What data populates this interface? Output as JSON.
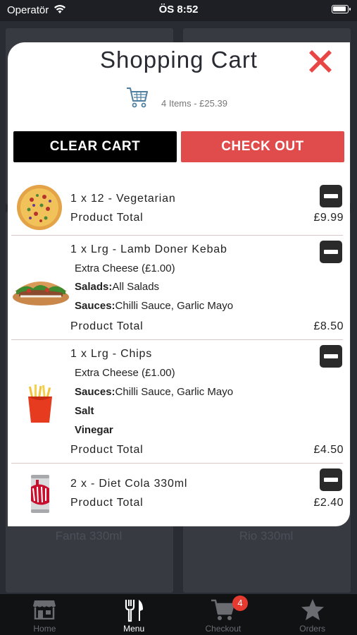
{
  "status_bar": {
    "carrier": "Operatör",
    "time": "ÖS 8:52"
  },
  "background": {
    "card_labels": [
      "Fanta 330ml",
      "Rio 330ml"
    ]
  },
  "modal": {
    "title": "Shopping Cart",
    "summary": "4 Items - £25.39",
    "clear_label": "CLEAR CART",
    "checkout_label": "CHECK OUT"
  },
  "items": [
    {
      "name": "1 x 12 - Vegetarian",
      "total_label": "Product Total",
      "price": "£9.99",
      "image": "pizza"
    },
    {
      "name": "1 x Lrg - Lamb Doner Kebab",
      "extra": "Extra Cheese (£1.00)",
      "salads_key": "Salads:",
      "salads_val": "All Salads",
      "sauces_key": "Sauces:",
      "sauces_val": "Chilli Sauce, Garlic Mayo",
      "total_label": "Product Total",
      "price": "£8.50",
      "image": "kebab"
    },
    {
      "name": "1 x Lrg - Chips",
      "extra": "Extra Cheese (£1.00)",
      "sauces_key": "Sauces:",
      "sauces_val": "Chilli Sauce, Garlic Mayo",
      "option1": "Salt",
      "option2": "Vinegar",
      "total_label": "Product Total",
      "price": "£4.50",
      "image": "chips"
    },
    {
      "name": "2 x - Diet Cola 330ml",
      "total_label": "Product Total",
      "price": "£2.40",
      "image": "diet-cola"
    }
  ],
  "tabs": [
    {
      "label": "Home",
      "icon": "store-icon",
      "active": false
    },
    {
      "label": "Menu",
      "icon": "cutlery-icon",
      "active": true
    },
    {
      "label": "Checkout",
      "icon": "cart-icon",
      "active": false
    },
    {
      "label": "Orders",
      "icon": "star-icon",
      "active": false
    }
  ],
  "checkout_badge": "4",
  "colors": {
    "accent": "#e04b4b",
    "close": "#e84545",
    "tab_active": "#ffffff",
    "tab_inactive": "#6a6c72"
  }
}
